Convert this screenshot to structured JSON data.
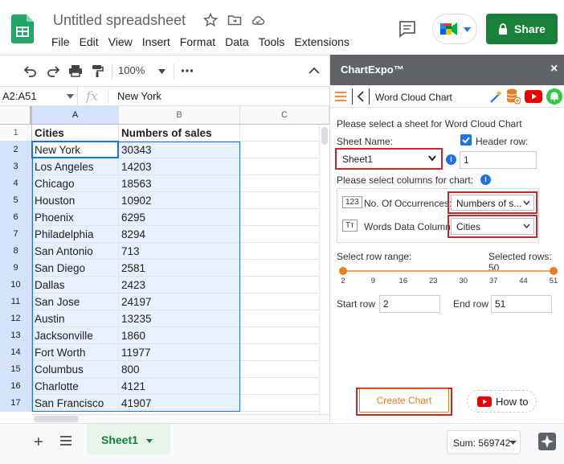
{
  "app": {
    "title": "Untitled spreadsheet",
    "menu": [
      "File",
      "Edit",
      "View",
      "Insert",
      "Format",
      "Data",
      "Tools",
      "Extensions"
    ],
    "share_label": "Share"
  },
  "toolbar": {
    "zoom": "100%"
  },
  "formula_bar": {
    "name_box": "A2:A51",
    "value": "New York"
  },
  "grid": {
    "columns": [
      "A",
      "B",
      "C"
    ],
    "rows": [
      {
        "n": "1",
        "a": "Cities",
        "b": "Numbers of sales"
      },
      {
        "n": "2",
        "a": "New York",
        "b": "30343"
      },
      {
        "n": "3",
        "a": "Los Angeles",
        "b": "14203"
      },
      {
        "n": "4",
        "a": "Chicago",
        "b": "18563"
      },
      {
        "n": "5",
        "a": "Houston",
        "b": "10902"
      },
      {
        "n": "6",
        "a": "Phoenix",
        "b": "6295"
      },
      {
        "n": "7",
        "a": "Philadelphia",
        "b": "8294"
      },
      {
        "n": "8",
        "a": "San Antonio",
        "b": "713"
      },
      {
        "n": "9",
        "a": "San Diego",
        "b": "2581"
      },
      {
        "n": "10",
        "a": "Dallas",
        "b": "2423"
      },
      {
        "n": "11",
        "a": "San Jose",
        "b": "24197"
      },
      {
        "n": "12",
        "a": "Austin",
        "b": "13235"
      },
      {
        "n": "13",
        "a": "Jacksonville",
        "b": "1860"
      },
      {
        "n": "14",
        "a": "Fort Worth",
        "b": "11977"
      },
      {
        "n": "15",
        "a": "Columbus",
        "b": "800"
      },
      {
        "n": "16",
        "a": "Charlotte",
        "b": "4121"
      },
      {
        "n": "17",
        "a": "San Francisco",
        "b": "41907"
      }
    ]
  },
  "panel": {
    "title": "ChartExpo™",
    "close": "×",
    "chart_name": "Word Cloud Chart",
    "select_sheet_text": "Please select a sheet for Word Cloud Chart",
    "sheet_name_label": "Sheet Name:",
    "sheet_value": "Sheet1",
    "header_row_label": "Header row:",
    "header_row_value": "1",
    "select_columns_text": "Please select columns for chart:",
    "occ_badge": "123",
    "occ_label": "No. Of Occurrences:",
    "occ_value": "Numbers of s...",
    "words_badge": "Tт",
    "words_label": "Words Data Column:",
    "words_value": "Cities",
    "row_range_label": "Select row range:",
    "selected_rows_label": "Selected rows: 50",
    "ticks": [
      "2",
      "9",
      "16",
      "23",
      "30",
      "37",
      "44",
      "51"
    ],
    "start_row_label": "Start row",
    "start_row_value": "2",
    "end_row_label": "End row",
    "end_row_value": "51",
    "create_label": "Create Chart",
    "howto_label": "How to"
  },
  "bottom": {
    "sheet_tab": "Sheet1",
    "sum": "Sum: 569742"
  },
  "colors": {
    "sheets_green": "#188038",
    "accent_orange": "#e67e22",
    "highlight_red": "#c62828",
    "selection_blue": "#1a73e8"
  }
}
